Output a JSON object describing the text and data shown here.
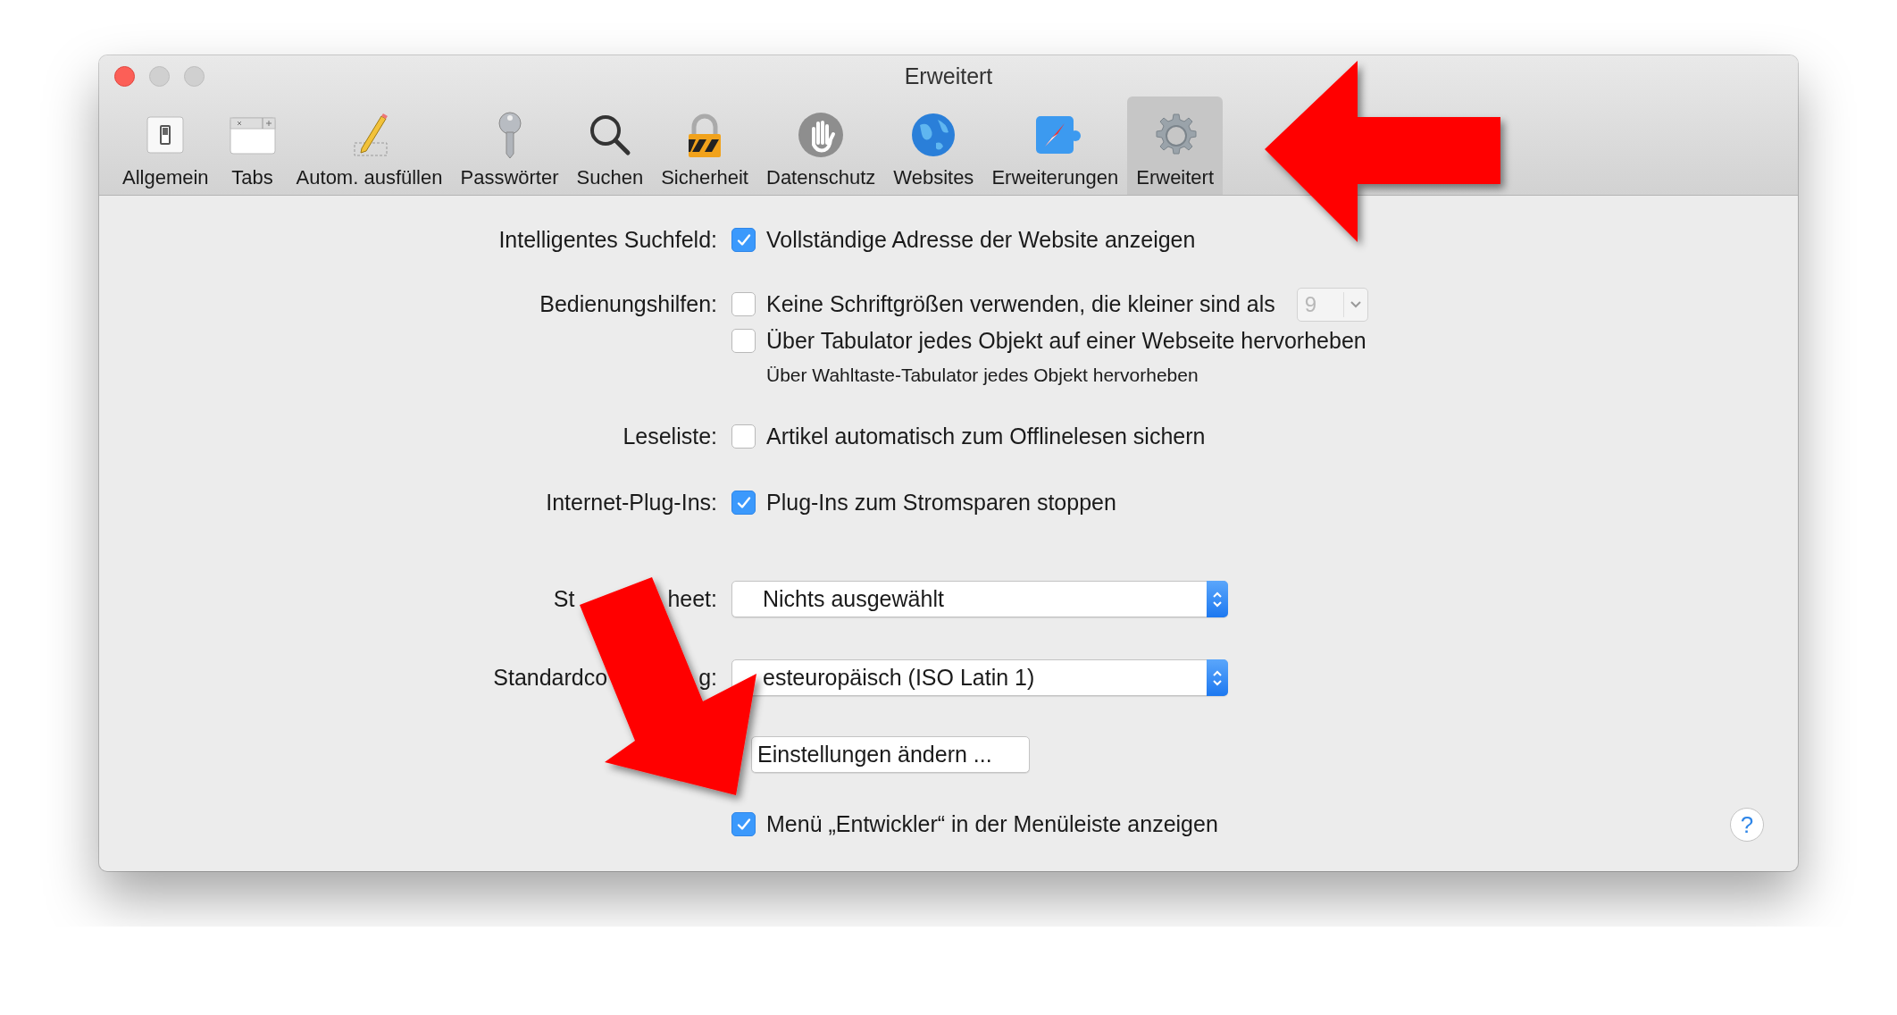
{
  "window": {
    "title": "Erweitert"
  },
  "toolbar": [
    {
      "label": "Allgemein",
      "selected": false
    },
    {
      "label": "Tabs",
      "selected": false
    },
    {
      "label": "Autom. ausfüllen",
      "selected": false
    },
    {
      "label": "Passwörter",
      "selected": false
    },
    {
      "label": "Suchen",
      "selected": false
    },
    {
      "label": "Sicherheit",
      "selected": false
    },
    {
      "label": "Datenschutz",
      "selected": false
    },
    {
      "label": "Websites",
      "selected": false
    },
    {
      "label": "Erweiterungen",
      "selected": false
    },
    {
      "label": "Erweitert",
      "selected": true
    }
  ],
  "settings": [
    {
      "kind": "checks",
      "label_parts": [
        "Intelligentes Suchfeld:"
      ],
      "options": [
        {
          "kind": "checkbox",
          "label": "Vollständige Adresse der Website anzeigen",
          "checked": true
        }
      ]
    },
    {
      "kind": "checks",
      "label_parts": [
        "Bedienungshilfen:"
      ],
      "options": [
        {
          "kind": "checkbox-size",
          "label": "Keine Schriftgrößen verwenden, die kleiner sind als",
          "checked": false,
          "size": "9",
          "size_disabled": true
        },
        {
          "kind": "checkbox",
          "label": "Über Tabulator jedes Objekt auf einer Webseite hervorheben",
          "checked": false
        },
        {
          "kind": "note",
          "label": "Über Wahltaste-Tabulator jedes Objekt hervorheben"
        }
      ]
    },
    {
      "kind": "checks",
      "label_parts": [
        "Leseliste:"
      ],
      "options": [
        {
          "kind": "checkbox",
          "label": "Artikel automatisch zum Offlinelesen sichern",
          "checked": false
        }
      ]
    },
    {
      "kind": "checks",
      "label_parts": [
        "Internet-Plug-Ins:"
      ],
      "options": [
        {
          "kind": "checkbox",
          "label": "Plug-Ins zum Stromsparen stoppen",
          "checked": true
        }
      ]
    },
    {
      "kind": "popup",
      "label_parts": [
        "St",
        "heet:"
      ],
      "value": "Nichts ausgewählt"
    },
    {
      "kind": "popup",
      "label_parts": [
        "Standardco",
        "g:"
      ],
      "value": "esteuropäisch (ISO Latin 1)"
    },
    {
      "kind": "button",
      "label": "Einstellungen ändern ..."
    },
    {
      "kind": "checks",
      "options": [
        {
          "kind": "checkbox",
          "label": "Menü „Entwickler“ in der Menüleiste anzeigen",
          "checked": true
        }
      ]
    }
  ],
  "help": "?"
}
